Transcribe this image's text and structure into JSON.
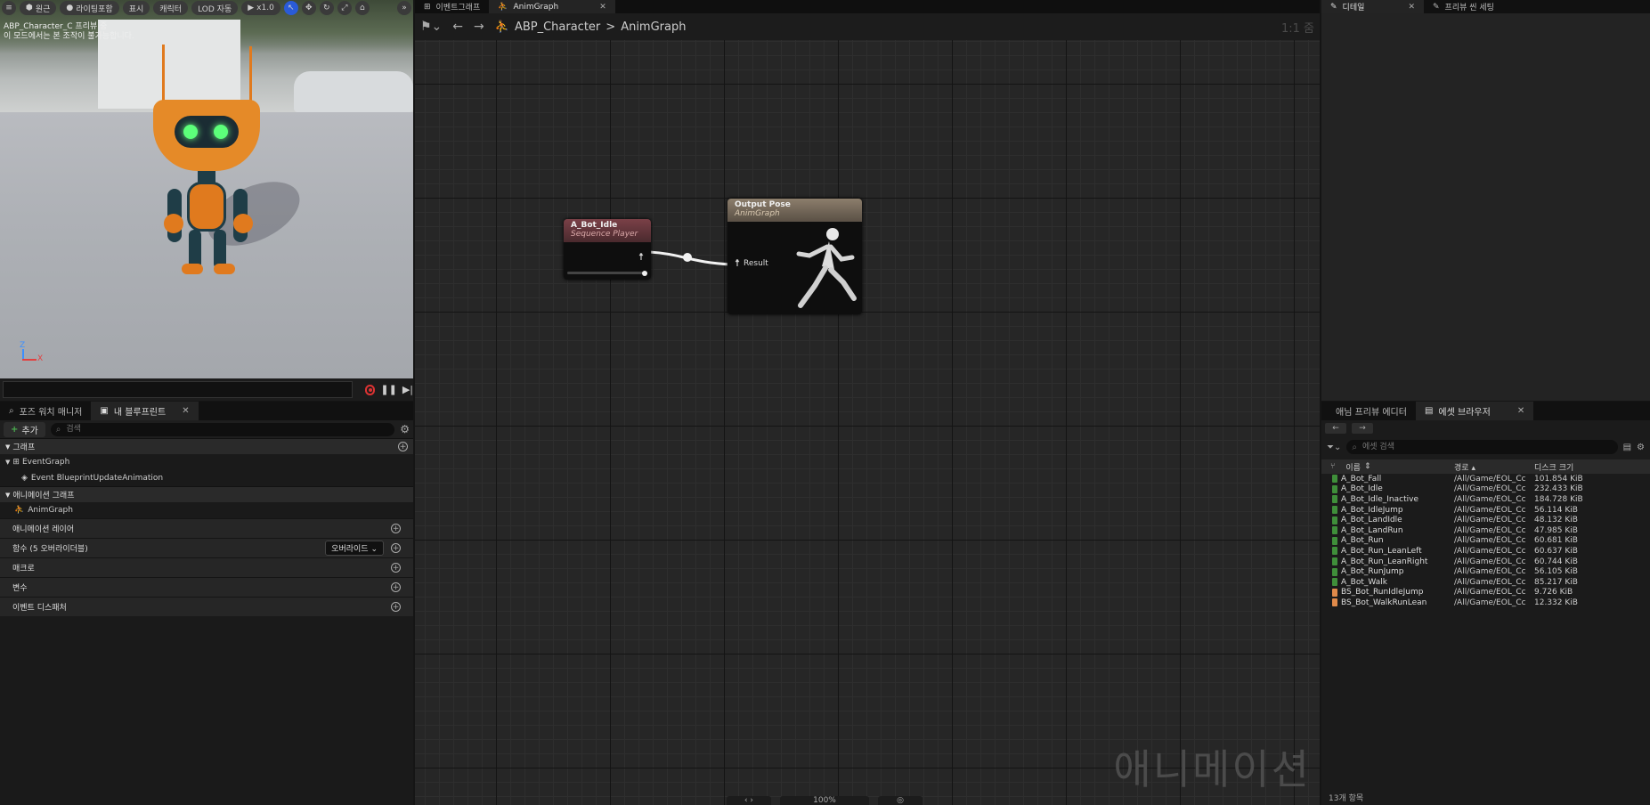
{
  "viewport": {
    "toolbar": {
      "menu_label": "≡",
      "perspective_label": "원근",
      "lighting_label": "라이팅포함",
      "show_label": "표시",
      "character_label": "캐릭터",
      "lod_label": "LOD 자동",
      "speed_label": "x1.0"
    },
    "caption_line1": "ABP_Character_C 프리뷰 중",
    "caption_line2": "이 모드에서는 본 조작이 불가능합니다.",
    "axis_z": "Z",
    "axis_x": "X"
  },
  "blueprint_panel": {
    "tabs": [
      {
        "label": "포즈 워치 매니저"
      },
      {
        "label": "내 블루프린트"
      }
    ],
    "add_label": "추가",
    "search_placeholder": "검색",
    "sections": {
      "graph": "그래프",
      "event_graph": "EventGraph",
      "event_item": "Event BlueprintUpdateAnimation",
      "anim_graph_head": "애니메이션 그래프",
      "anim_graph": "AnimGraph",
      "anim_layers": "애니메이션 레이어",
      "functions": "함수 (5 오버라이더블)",
      "override_label": "오버라이드",
      "macros": "매크로",
      "variables": "변수",
      "dispatchers": "이벤트 디스패처"
    }
  },
  "graph": {
    "tabs": [
      {
        "label": "이벤트그래프"
      },
      {
        "label": "AnimGraph"
      }
    ],
    "breadcrumb": {
      "root": "ABP_Character",
      "separator": ">",
      "current": "AnimGraph"
    },
    "zoom_label": "1:1 줌",
    "nodes": {
      "idle_title": "A_Bot_Idle",
      "idle_subtitle": "Sequence Player",
      "output_title": "Output Pose",
      "output_subtitle": "AnimGraph",
      "result_label": "Result"
    },
    "watermark": "애니메이션",
    "zoom_bar_text": "100%"
  },
  "details_panel": {
    "tabs": [
      {
        "label": "디테일"
      },
      {
        "label": "프리뷰 씬 세팅"
      }
    ]
  },
  "asset_browser": {
    "tabs": [
      {
        "label": "애님 프리뷰 에디터"
      },
      {
        "label": "에셋 브라우저"
      }
    ],
    "search_placeholder": "에셋 검색",
    "columns": {
      "name": "이름",
      "path": "경로",
      "size": "디스크 크기"
    },
    "rows": [
      {
        "name": "A_Bot_Fall",
        "path": "/All/Game/EOL_Cc",
        "size": "101.854 KiB",
        "type": "anim"
      },
      {
        "name": "A_Bot_Idle",
        "path": "/All/Game/EOL_Cc",
        "size": "232.433 KiB",
        "type": "anim"
      },
      {
        "name": "A_Bot_Idle_Inactive",
        "path": "/All/Game/EOL_Cc",
        "size": "184.728 KiB",
        "type": "anim"
      },
      {
        "name": "A_Bot_IdleJump",
        "path": "/All/Game/EOL_Cc",
        "size": "56.114 KiB",
        "type": "anim"
      },
      {
        "name": "A_Bot_LandIdle",
        "path": "/All/Game/EOL_Cc",
        "size": "48.132 KiB",
        "type": "anim"
      },
      {
        "name": "A_Bot_LandRun",
        "path": "/All/Game/EOL_Cc",
        "size": "47.985 KiB",
        "type": "anim"
      },
      {
        "name": "A_Bot_Run",
        "path": "/All/Game/EOL_Cc",
        "size": "60.681 KiB",
        "type": "anim"
      },
      {
        "name": "A_Bot_Run_LeanLeft",
        "path": "/All/Game/EOL_Cc",
        "size": "60.637 KiB",
        "type": "anim"
      },
      {
        "name": "A_Bot_Run_LeanRight",
        "path": "/All/Game/EOL_Cc",
        "size": "60.744 KiB",
        "type": "anim"
      },
      {
        "name": "A_Bot_RunJump",
        "path": "/All/Game/EOL_Cc",
        "size": "56.105 KiB",
        "type": "anim"
      },
      {
        "name": "A_Bot_Walk",
        "path": "/All/Game/EOL_Cc",
        "size": "85.217 KiB",
        "type": "anim"
      },
      {
        "name": "BS_Bot_RunIdleJump",
        "path": "/All/Game/EOL_Cc",
        "size": "9.726 KiB",
        "type": "blendspace"
      },
      {
        "name": "BS_Bot_WalkRunLean",
        "path": "/All/Game/EOL_Cc",
        "size": "12.332 KiB",
        "type": "blendspace"
      }
    ],
    "count_label": "13개 항목"
  },
  "colors": {
    "anim_asset": "#3f8f3a",
    "blendspace_asset": "#e08a4a",
    "accent_blue": "#2a5bd7"
  }
}
